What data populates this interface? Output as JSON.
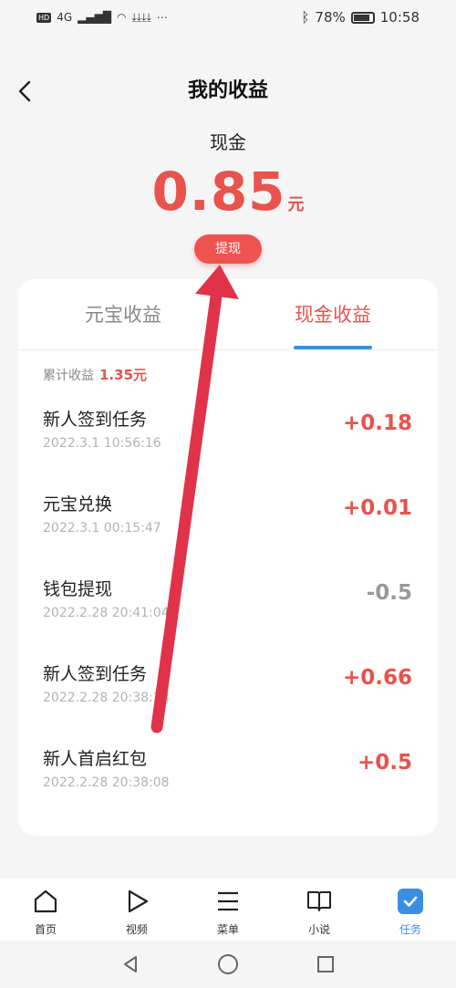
{
  "status": {
    "network": "4G",
    "battery": "78%",
    "time": "10:58"
  },
  "header": {
    "title": "我的收益"
  },
  "cash": {
    "label": "现金",
    "amount": "0.85",
    "unit": "元",
    "withdraw_label": "提现"
  },
  "tabs": [
    {
      "label": "元宝收益",
      "active": false
    },
    {
      "label": "现金收益",
      "active": true
    }
  ],
  "summary": {
    "label": "累计收益",
    "total": "1.35元"
  },
  "records": [
    {
      "title": "新人签到任务",
      "time": "2022.3.1 10:56:16",
      "value": "+0.18"
    },
    {
      "title": "元宝兑换",
      "time": "2022.3.1 00:15:47",
      "value": "+0.01"
    },
    {
      "title": "钱包提现",
      "time": "2022.2.28 20:41:04",
      "value": "-0.5"
    },
    {
      "title": "新人签到任务",
      "time": "2022.2.28 20:38:18",
      "value": "+0.66"
    },
    {
      "title": "新人首启红包",
      "time": "2022.2.28 20:38:08",
      "value": "+0.5"
    }
  ],
  "tabbar": [
    {
      "label": "首页",
      "icon": "home-icon"
    },
    {
      "label": "视频",
      "icon": "play-icon"
    },
    {
      "label": "菜单",
      "icon": "menu-icon"
    },
    {
      "label": "小说",
      "icon": "book-icon"
    },
    {
      "label": "任务",
      "icon": "task-check-icon",
      "active": true
    }
  ],
  "colors": {
    "accent_red": "#e9524d",
    "accent_blue": "#3b8fe0",
    "annotation_arrow": "#e0334a"
  }
}
